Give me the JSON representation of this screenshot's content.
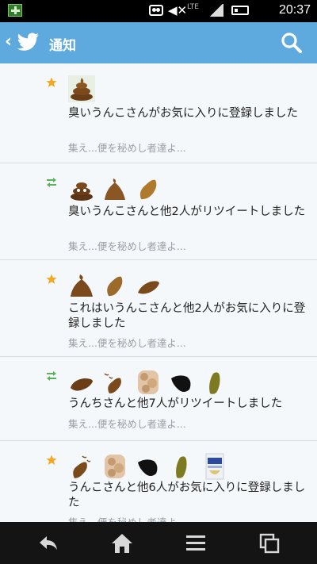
{
  "status_bar": {
    "time": "20:37",
    "network": "LTE"
  },
  "app_bar": {
    "back_glyph": "‹",
    "title": "通知"
  },
  "notifications": [
    {
      "kind": "favorite-star-icon",
      "avatars": [
        "poop-swirl"
      ],
      "message": "臭いうんこさんがお気に入りに登録しました",
      "snippet": "集え...便を秘めし者達よ..."
    },
    {
      "kind": "retweet-icon",
      "avatars": [
        "poop-swirl",
        "poop-pile",
        "poop-lump"
      ],
      "message": "臭いうんこさんと他2人がリツイートしました",
      "snippet": "集え...便を秘めし者達よ..."
    },
    {
      "kind": "favorite-star-icon",
      "avatars": [
        "poop-pile",
        "poop-lump",
        "poop-lump"
      ],
      "message": "これはいうんこさんと他2人がお気に入りに登録しました",
      "snippet": "集え...便を秘めし者達よ..."
    },
    {
      "kind": "retweet-icon",
      "avatars": [
        "poop-lump",
        "poop-unko",
        "blurred",
        "black-lump",
        "olive-lump"
      ],
      "message": "うんちさんと他7人がリツイートしました",
      "snippet": "集え...便を秘めし者達よ..."
    },
    {
      "kind": "favorite-star-icon",
      "avatars": [
        "poop-unko",
        "blurred",
        "black-lump",
        "olive-lump",
        "milk-carton"
      ],
      "message": "うんこさんと他6人がお気に入りに登録しました",
      "snippet": "集え...便を秘めし者達よ..."
    }
  ],
  "colors": {
    "app_bar": "#5ea9dd",
    "list_bg": "#f5f8fa",
    "star": "#f5a623",
    "retweet": "#5ab35a",
    "poop": "#7a4a1c"
  }
}
